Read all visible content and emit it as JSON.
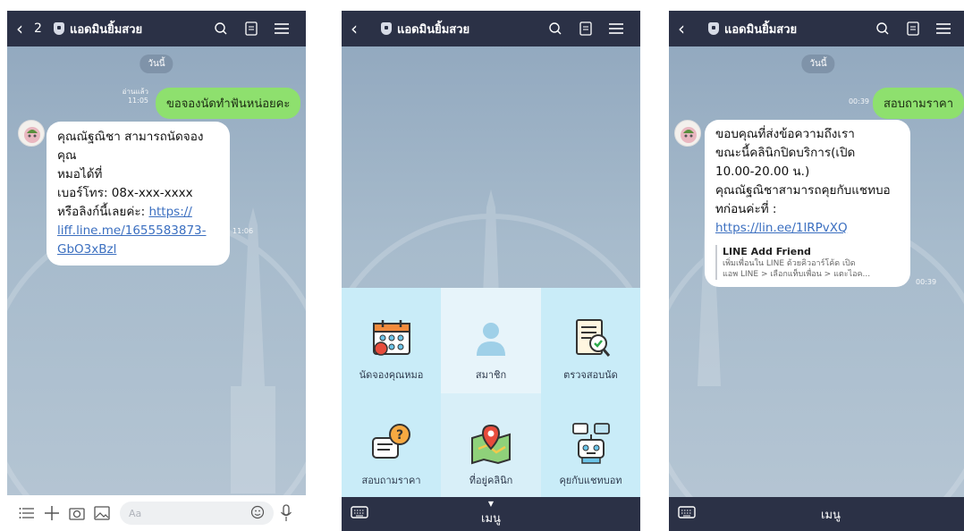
{
  "chat_name": "แอดมินยิ้มสวย",
  "unread_count": "2",
  "date_badge": "วันนี้",
  "screen1": {
    "sent_message": "ขอจองนัดทำฟันหน่อยคะ",
    "sent_status": "อ่านแล้ว",
    "sent_time": "11:05",
    "reply_line1": "คุณณัฐณิชา สามารถนัดจองคุณ",
    "reply_line2": "หมอได้ที่",
    "reply_line3": "เบอร์โทร: 08x-xxx-xxxx",
    "reply_line4_prefix": "หรือลิงก์นี้เลยค่ะ: ",
    "reply_link": "https://liff.line.me/1655583873-GbO3xBzl",
    "reply_link_a": "https://",
    "reply_link_b": "liff.line.me/1655583873-",
    "reply_link_c": "GbO3xBzl",
    "reply_time": "11:06",
    "input_placeholder": "Aa"
  },
  "screen2": {
    "menu_label": "เมนู",
    "menu_items": [
      {
        "label": "นัดจองคุณหมอ",
        "icon": "calendar-icon"
      },
      {
        "label": "สมาชิก",
        "icon": "member-icon"
      },
      {
        "label": "ตรวจสอบนัด",
        "icon": "check-appointment-icon"
      },
      {
        "label": "สอบถามราคา",
        "icon": "ask-price-icon"
      },
      {
        "label": "ที่อยู่คลินิก",
        "icon": "map-icon"
      },
      {
        "label": "คุยกับแชทบอท",
        "icon": "chatbot-icon"
      }
    ]
  },
  "screen3": {
    "sent_message": "สอบถามราคา",
    "sent_time": "00:39",
    "reply_line1": "ขอบคุณที่ส่งข้อความถึงเรา",
    "reply_line2": "ขณะนี้คลินิกปิดบริการ(เปิด",
    "reply_line3": "10.00-20.00 น.)",
    "reply_line4": "คุณณัฐณิชาสามารถคุยกับแชทบอ",
    "reply_line5": "ทก่อนค่ะที่ :",
    "reply_link": "https://lin.ee/1lRPvXQ",
    "card_title": "LINE Add Friend",
    "card_desc1": "เพิ่มเพื่อนใน LINE ด้วยคิวอาร์โค้ด เปิด",
    "card_desc2": "แอพ LINE > เลือกแท็บเพื่อน > แตะไอค...",
    "reply_time": "00:39",
    "menu_label": "เมนู"
  }
}
